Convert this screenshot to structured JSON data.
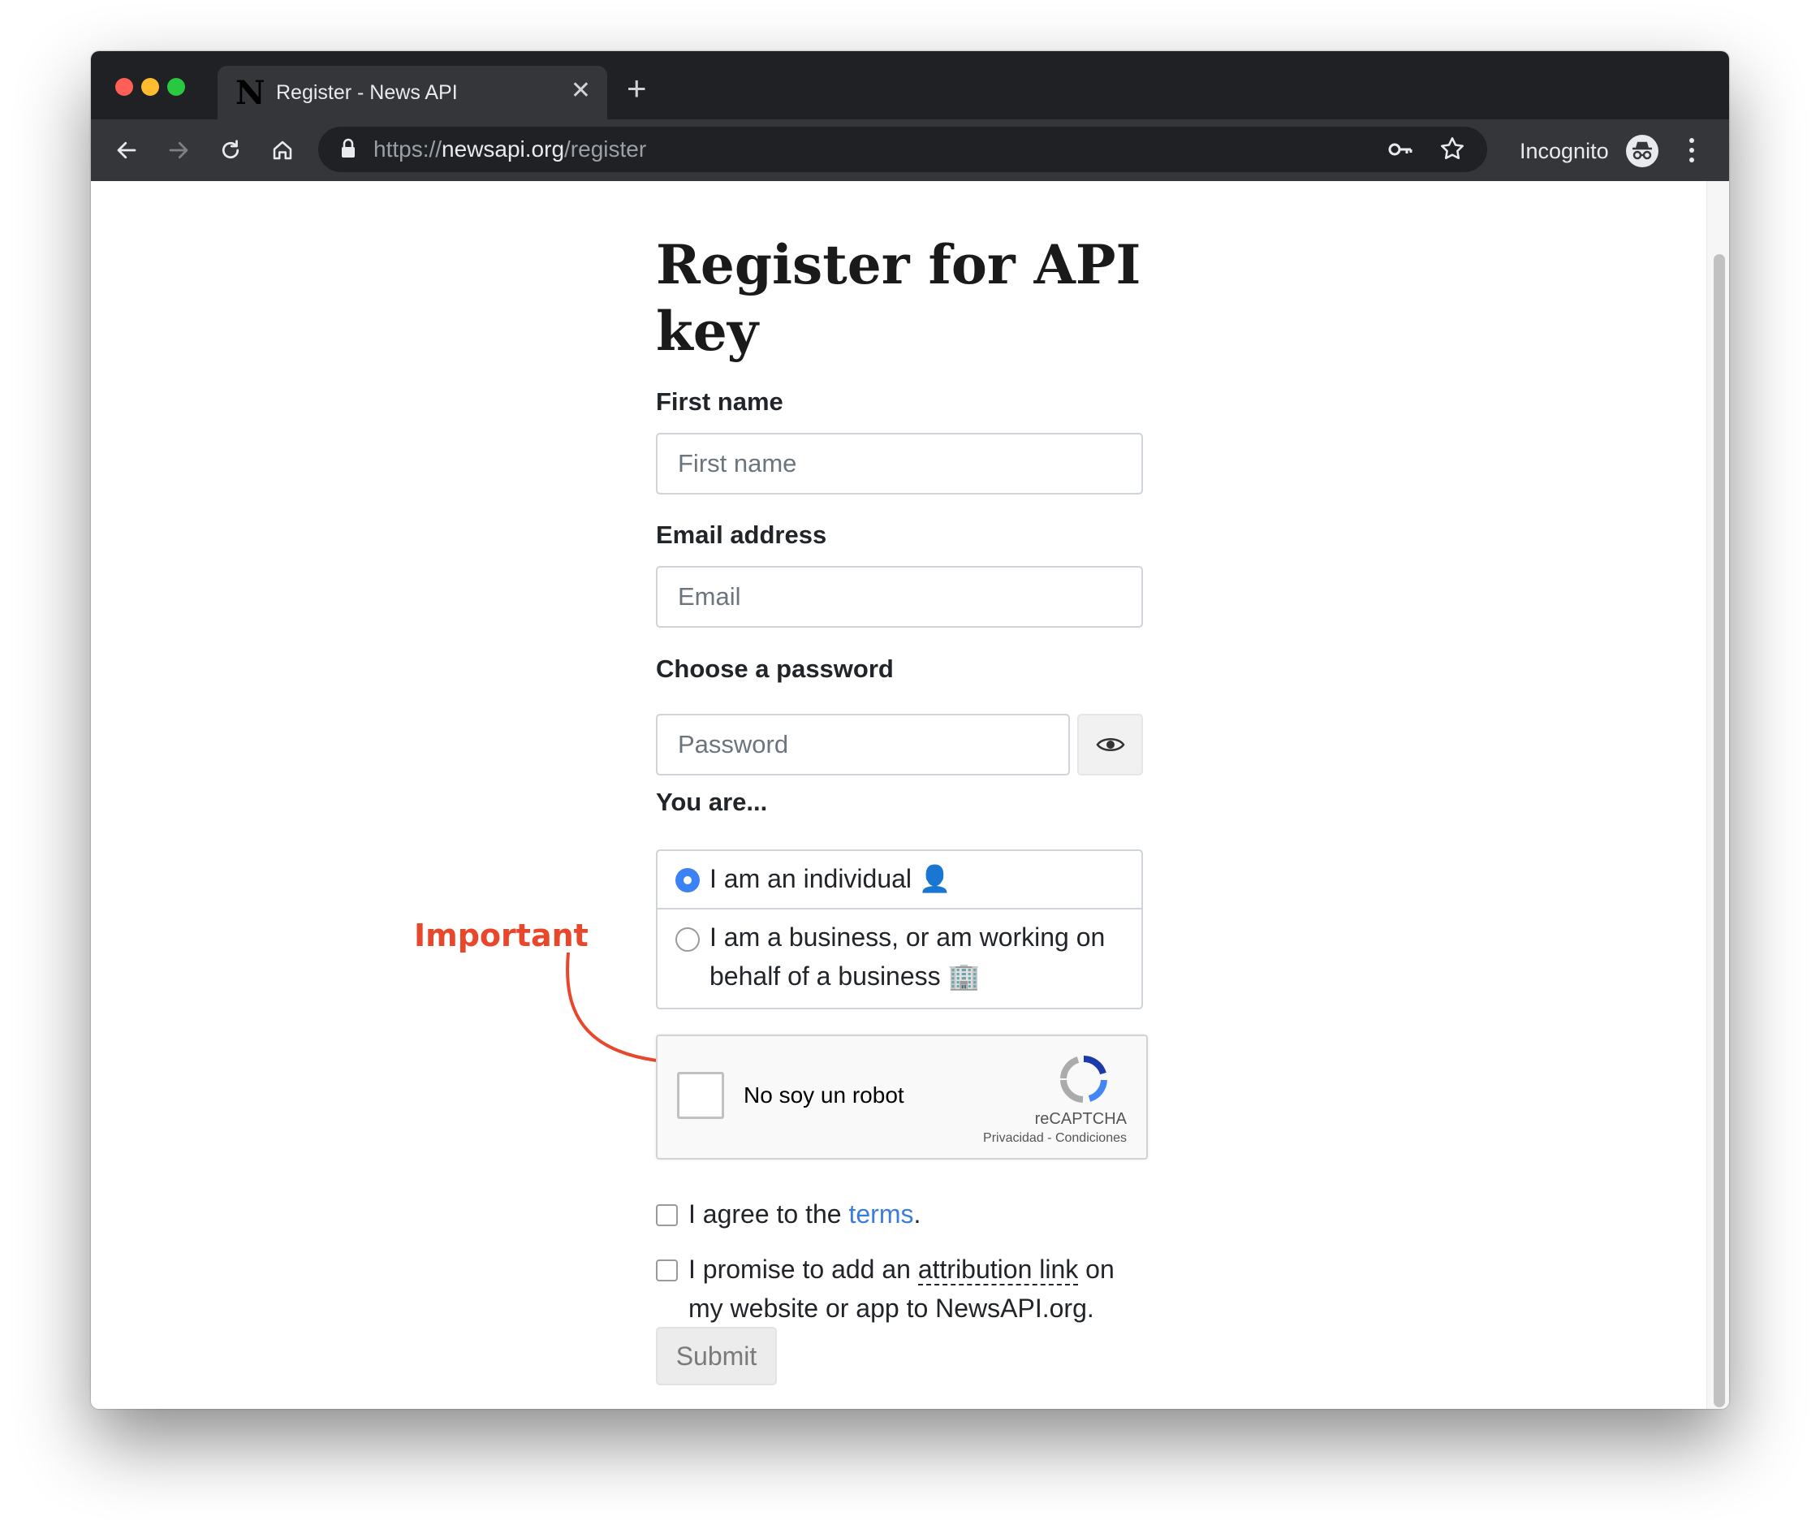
{
  "browser": {
    "tab_title": "Register - News API",
    "tab_favicon": "N",
    "tab_close": "✕",
    "new_tab": "+",
    "url_scheme": "https://",
    "url_host": "newsapi.org",
    "url_path": "/register",
    "incognito_label": "Incognito",
    "icons": [
      "back-icon",
      "forward-icon",
      "reload-icon",
      "home-icon",
      "lock-icon",
      "key-icon",
      "star-icon",
      "incognito-icon",
      "menu-icon"
    ],
    "traffic_lights": [
      "#ff5f57",
      "#febc2e",
      "#28c840"
    ]
  },
  "form": {
    "title": "Register for API key",
    "first_name": {
      "label": "First name",
      "placeholder": "First name"
    },
    "email": {
      "label": "Email address",
      "placeholder": "Email"
    },
    "password": {
      "label": "Choose a password",
      "placeholder": "Password"
    },
    "you_are": {
      "label": "You are...",
      "options": [
        {
          "text": "I am an individual",
          "emoji": "👤",
          "selected": true
        },
        {
          "text": "I am a business, or am working on behalf of a business",
          "emoji": "🏢",
          "selected": false
        }
      ]
    },
    "captcha": {
      "text": "No soy un robot",
      "brand": "reCAPTCHA",
      "links": "Privacidad - Condiciones"
    },
    "terms": {
      "prefix": "I agree to the ",
      "link": "terms",
      "suffix": "."
    },
    "attribution": {
      "prefix": "I promise to add an ",
      "link": "attribution link",
      "suffix": " on my website or app to NewsAPI.org."
    },
    "submit": "Submit"
  },
  "annotation": {
    "text": "Important",
    "color": "#e8472b"
  },
  "colors": {
    "accent": "#3b82f6",
    "link": "#3b7ddd",
    "chrome_dark": "#202124",
    "chrome_toolbar": "#35363a"
  }
}
